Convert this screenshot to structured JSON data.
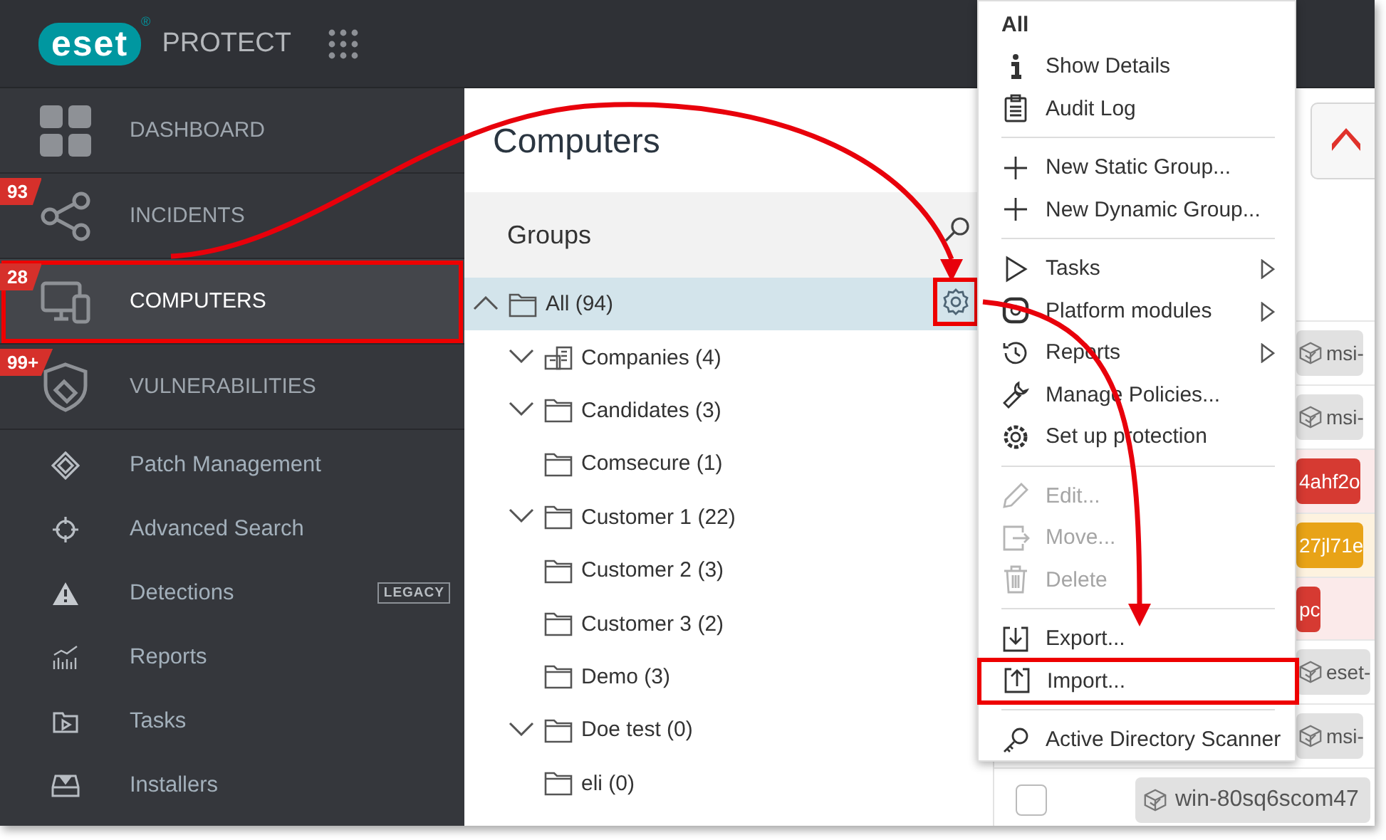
{
  "header": {
    "logo": "eset",
    "logo_mark": "®",
    "product": "PROTECT"
  },
  "sidebar": {
    "primary": [
      {
        "label": "DASHBOARD",
        "kind": "dashboard",
        "selected": false,
        "highlighted": false
      },
      {
        "label": "INCIDENTS",
        "kind": "incidents",
        "badge": "93",
        "selected": false,
        "highlighted": false
      },
      {
        "label": "COMPUTERS",
        "kind": "computers",
        "badge": "28",
        "selected": true,
        "highlighted": true
      },
      {
        "label": "VULNERABILITIES",
        "kind": "vulnerabilities",
        "badge": "99+",
        "selected": false,
        "highlighted": false
      }
    ],
    "secondary": [
      {
        "label": "Patch Management",
        "kind": "patch"
      },
      {
        "label": "Advanced Search",
        "kind": "target"
      },
      {
        "label": "Detections",
        "kind": "warning",
        "tag": "LEGACY"
      },
      {
        "label": "Reports",
        "kind": "reports"
      },
      {
        "label": "Tasks",
        "kind": "tasks"
      },
      {
        "label": "Installers",
        "kind": "installers"
      }
    ]
  },
  "page": {
    "title": "Computers",
    "groups_title": "Groups"
  },
  "tree": [
    {
      "label": "All (94)",
      "kind": "folder",
      "expandable": true,
      "expanded": true,
      "selected": true,
      "children": [
        {
          "label": "Companies (4)",
          "kind": "company",
          "expandable": true,
          "expanded": false,
          "selected": false
        },
        {
          "label": "Candidates (3)",
          "kind": "folder",
          "expandable": true,
          "expanded": false,
          "selected": false
        },
        {
          "label": "Comsecure (1)",
          "kind": "folder",
          "expandable": false,
          "expanded": false,
          "selected": false
        },
        {
          "label": "Customer 1 (22)",
          "kind": "folder",
          "expandable": true,
          "expanded": false,
          "selected": false
        },
        {
          "label": "Customer 2 (3)",
          "kind": "folder",
          "expandable": false,
          "expanded": false,
          "selected": false
        },
        {
          "label": "Customer 3 (2)",
          "kind": "folder",
          "expandable": false,
          "expanded": false,
          "selected": false
        },
        {
          "label": "Demo (3)",
          "kind": "folder",
          "expandable": false,
          "expanded": false,
          "selected": false
        },
        {
          "label": "Doe test (0)",
          "kind": "folder",
          "expandable": true,
          "expanded": false,
          "selected": false
        },
        {
          "label": "eli (0)",
          "kind": "folder",
          "expandable": false,
          "expanded": false,
          "selected": false
        }
      ]
    }
  ],
  "devices": [
    {
      "name": "msi-",
      "kind": "ok"
    },
    {
      "name": "msi-",
      "kind": "ok"
    },
    {
      "name": "4ahf2o",
      "kind": "critical"
    },
    {
      "name": "27jl71e",
      "kind": "warning"
    },
    {
      "name": "pc",
      "kind": "critical"
    },
    {
      "name": "eset-",
      "kind": "ok"
    },
    {
      "name": "msi-",
      "kind": "ok"
    },
    {
      "name": "win-80sq6scom47",
      "kind": "ok",
      "checkbox": {
        "checked": false
      }
    }
  ],
  "context_menu": {
    "title": "All",
    "sections": [
      [
        {
          "label": "Show Details",
          "kind": "info",
          "submenu": false,
          "disabled": false,
          "highlighted": false
        },
        {
          "label": "Audit Log",
          "kind": "clipboard",
          "submenu": false,
          "disabled": false,
          "highlighted": false
        }
      ],
      [
        {
          "label": "New Static Group...",
          "kind": "plus",
          "submenu": false,
          "disabled": false,
          "highlighted": false
        },
        {
          "label": "New Dynamic Group...",
          "kind": "plus",
          "submenu": false,
          "disabled": false,
          "highlighted": false
        }
      ],
      [
        {
          "label": "Tasks",
          "kind": "play",
          "submenu": true,
          "disabled": false,
          "highlighted": false
        },
        {
          "label": "Platform modules",
          "kind": "module",
          "submenu": true,
          "disabled": false,
          "highlighted": false
        },
        {
          "label": "Reports",
          "kind": "history",
          "submenu": true,
          "disabled": false,
          "highlighted": false
        },
        {
          "label": "Manage Policies...",
          "kind": "wrench",
          "submenu": false,
          "disabled": false,
          "highlighted": false
        },
        {
          "label": "Set up protection",
          "kind": "gear",
          "submenu": false,
          "disabled": false,
          "highlighted": false
        }
      ],
      [
        {
          "label": "Edit...",
          "kind": "pencil",
          "submenu": false,
          "disabled": true,
          "highlighted": false
        },
        {
          "label": "Move...",
          "kind": "move",
          "submenu": false,
          "disabled": true,
          "highlighted": false
        },
        {
          "label": "Delete",
          "kind": "trash",
          "submenu": false,
          "disabled": true,
          "highlighted": false
        }
      ],
      [
        {
          "label": "Export...",
          "kind": "export",
          "submenu": false,
          "disabled": false,
          "highlighted": false
        },
        {
          "label": "Import...",
          "kind": "import",
          "submenu": false,
          "disabled": false,
          "highlighted": true
        }
      ],
      [
        {
          "label": "Active Directory Scanner",
          "kind": "key",
          "submenu": false,
          "disabled": false,
          "highlighted": false
        }
      ]
    ]
  }
}
